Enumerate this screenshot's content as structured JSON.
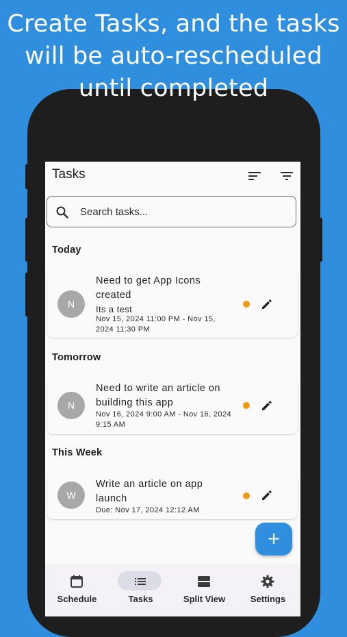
{
  "headline": {
    "line1": "Create Tasks, and the tasks",
    "line2": "will be auto-rescheduled",
    "line3": "until completed"
  },
  "appbar": {
    "title": "Tasks",
    "icons": [
      "sort-icon",
      "filter-icon"
    ]
  },
  "search": {
    "placeholder": "Search tasks..."
  },
  "sections": [
    {
      "label": "Today",
      "tasks": [
        {
          "avatar": "N",
          "title": "Need to get App Icons created",
          "subtitle": "Its a test",
          "date": "Nov 15, 2024 11:00 PM - Nov 15, 2024 11:30 PM",
          "priority_color": "#f39a12"
        }
      ]
    },
    {
      "label": "Tomorrow",
      "tasks": [
        {
          "avatar": "N",
          "title": "Need to write an article on building this app",
          "date": "Nov 16, 2024 9:00 AM - Nov 16, 2024 9:15 AM",
          "priority_color": "#f39a12"
        }
      ]
    },
    {
      "label": "This Week",
      "tasks": [
        {
          "avatar": "W",
          "title": "Write an article on app launch",
          "date": "Due: Nov 17, 2024 12:12 AM",
          "priority_color": "#f39a12"
        }
      ]
    }
  ],
  "fab": {
    "icon": "plus-icon",
    "label": "+"
  },
  "nav": {
    "items": [
      {
        "label": "Schedule",
        "icon": "calendar-icon"
      },
      {
        "label": "Tasks",
        "icon": "list-icon",
        "selected": true
      },
      {
        "label": "Split View",
        "icon": "split-view-icon"
      },
      {
        "label": "Settings",
        "icon": "gear-icon"
      }
    ]
  },
  "colors": {
    "background": "#2f8ede",
    "accent": "#2f8ede",
    "priority": "#f39a12",
    "avatar": "#a8a8a8"
  }
}
